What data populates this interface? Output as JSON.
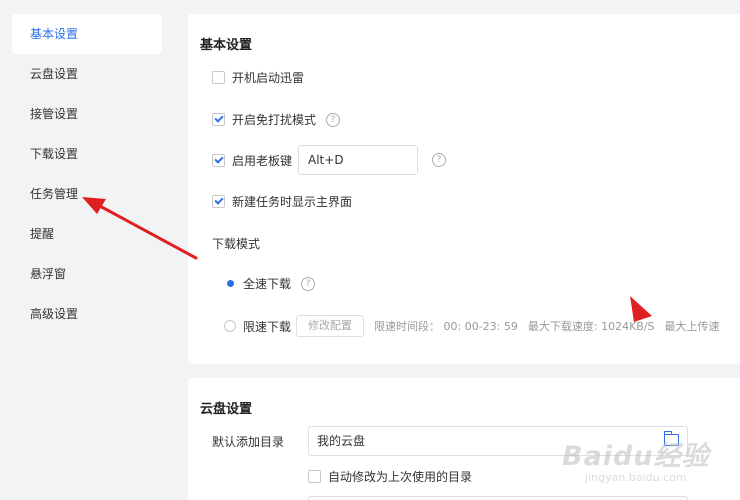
{
  "sidebar": {
    "items": [
      {
        "label": "基本设置",
        "active": true
      },
      {
        "label": "云盘设置",
        "active": false
      },
      {
        "label": "接管设置",
        "active": false
      },
      {
        "label": "下载设置",
        "active": false
      },
      {
        "label": "任务管理",
        "active": false
      },
      {
        "label": "提醒",
        "active": false
      },
      {
        "label": "悬浮窗",
        "active": false
      },
      {
        "label": "高级设置",
        "active": false
      }
    ]
  },
  "basic": {
    "title": "基本设置",
    "startup_label": "开机启动迅雷",
    "startup_checked": false,
    "dnd_label": "开启免打扰模式",
    "dnd_checked": true,
    "boss_key_label": "启用老板键",
    "boss_key_checked": true,
    "boss_key_value": "Alt+D",
    "show_main_label": "新建任务时显示主界面",
    "show_main_checked": true,
    "download_mode_label": "下载模式",
    "full_speed_label": "全速下载",
    "full_speed_selected": true,
    "limit_label": "限速下载",
    "limit_selected": false,
    "modify_config_label": "修改配置",
    "limit_period": "限速时间段：  00: 00-23: 59",
    "max_download": "最大下载速度: 1024KB/S",
    "max_upload": "最大上传速"
  },
  "cloud": {
    "title": "云盘设置",
    "default_dir_label": "默认添加目录",
    "default_dir_value": "我的云盘",
    "auto_modify_label": "自动修改为上次使用的目录",
    "auto_modify_checked": false
  },
  "icons": {
    "help": "question-circle-icon",
    "folder": "folder-icon"
  },
  "watermark": {
    "main": "Baidu经验",
    "sub": "jingyan.baidu.com"
  },
  "colors": {
    "accent": "#2b6ee8",
    "annotation": "#e02020"
  }
}
